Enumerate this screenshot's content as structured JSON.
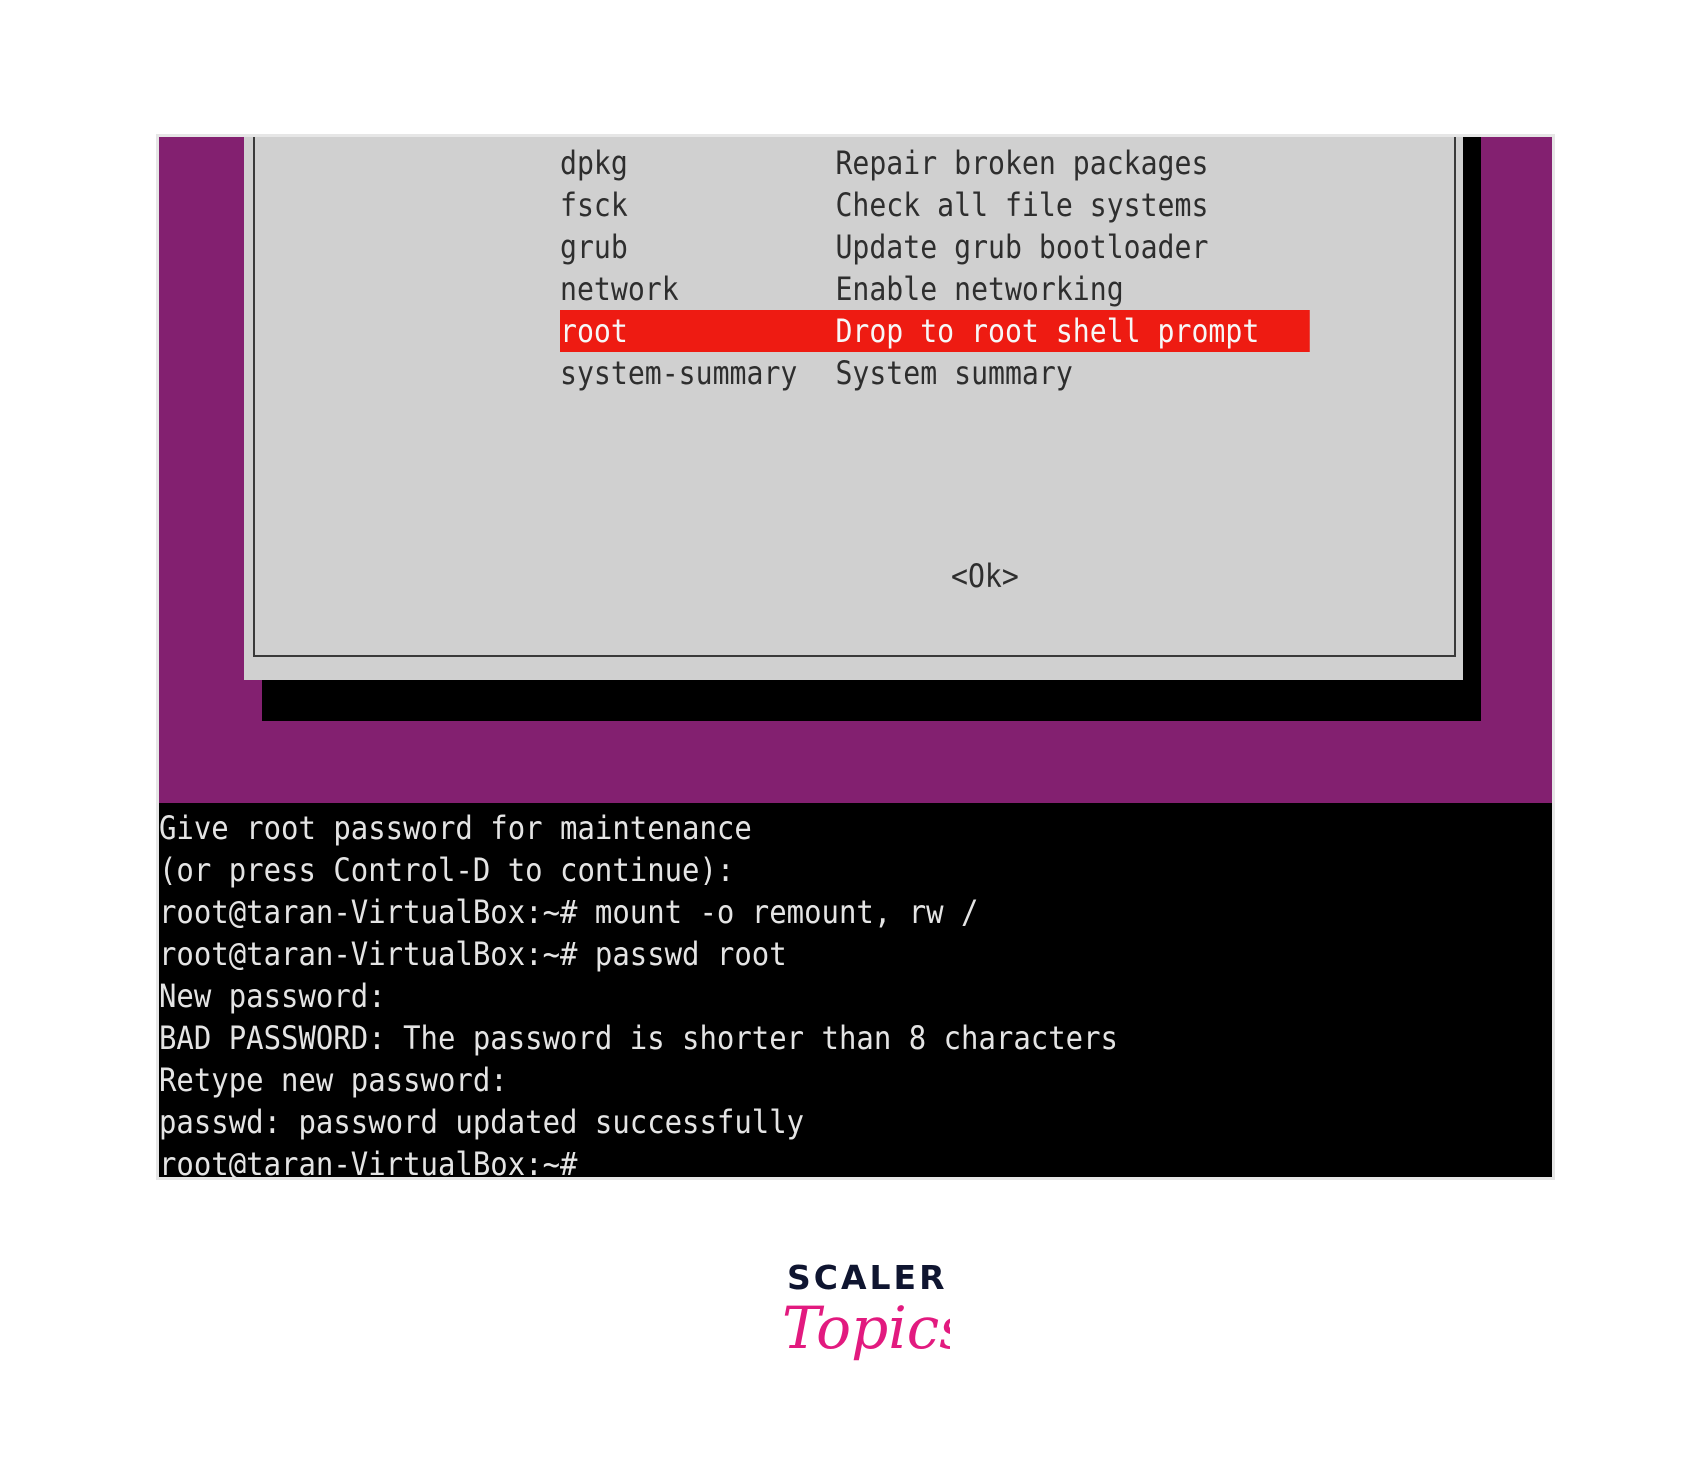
{
  "colors": {
    "desktop_bg": "#832070",
    "dialog_bg": "#d0d0d0",
    "selection": "#ee1b12",
    "terminal_bg": "#000000",
    "terminal_text": "#e4e4e4",
    "logo_dark": "#0f1530",
    "logo_pink": "#e21a7f"
  },
  "recovery_menu": {
    "items": [
      {
        "command": "dpkg",
        "description": "Repair broken packages",
        "selected": false
      },
      {
        "command": "fsck",
        "description": "Check all file systems",
        "selected": false
      },
      {
        "command": "grub",
        "description": "Update grub bootloader",
        "selected": false
      },
      {
        "command": "network",
        "description": "Enable networking",
        "selected": false
      },
      {
        "command": "root",
        "description": "Drop to root shell prompt",
        "selected": true
      },
      {
        "command": "system-summary",
        "description": "System summary",
        "selected": false
      }
    ],
    "ok_label": "<Ok>"
  },
  "terminal": {
    "lines": [
      "Give root password for maintenance",
      "(or press Control-D to continue):",
      "root@taran-VirtualBox:~# mount -o remount, rw /",
      "root@taran-VirtualBox:~# passwd root",
      "New password:",
      "BAD PASSWORD: The password is shorter than 8 characters",
      "Retype new password:",
      "passwd: password updated successfully",
      "root@taran-VirtualBox:~#"
    ]
  },
  "logo": {
    "top_text": "SCALER",
    "script_text": "Topics"
  }
}
